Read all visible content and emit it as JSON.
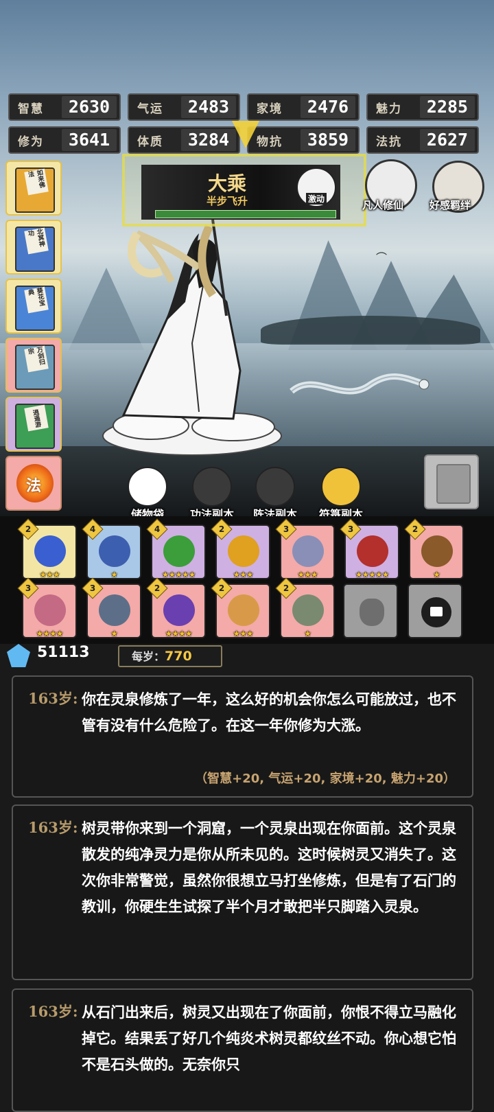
{
  "stats": [
    {
      "label": "智慧",
      "value": "2630"
    },
    {
      "label": "气运",
      "value": "2483"
    },
    {
      "label": "家境",
      "value": "2476"
    },
    {
      "label": "魅力",
      "value": "2285"
    },
    {
      "label": "修为",
      "value": "3641"
    },
    {
      "label": "体质",
      "value": "3284"
    },
    {
      "label": "物抗",
      "value": "3859"
    },
    {
      "label": "法抗",
      "value": "2627"
    }
  ],
  "realm": {
    "name": "大乘",
    "sub": "半步飞升",
    "action": "激动",
    "progress": 1.0
  },
  "portraits": [
    {
      "label": "凡人修仙",
      "icon": "taoist-character-icon"
    },
    {
      "label": "好感羁绊",
      "icon": "maiden-portrait-icon"
    }
  ],
  "books": [
    {
      "title": "如来佛法",
      "color": "#e7a933",
      "bg": "#f4e7a6"
    },
    {
      "title": "北冥神功",
      "color": "#4a78c8",
      "bg": "#f4e7a6"
    },
    {
      "title": "葵花宝典",
      "color": "#4a84d6",
      "bg": "#f4e7a6"
    },
    {
      "title": "万剑归宗",
      "color": "#6b9bb8",
      "bg": "#f3aaa8"
    },
    {
      "title": "逍遥游",
      "color": "#3d9e55",
      "bg": "#cdb0e0"
    }
  ],
  "fa_button": "法",
  "mid_buttons": [
    {
      "label": "储物袋",
      "locked": false
    },
    {
      "label": "功法副本",
      "locked": true
    },
    {
      "label": "阵法副本",
      "locked": true
    },
    {
      "label": "符箓副本",
      "locked": false
    }
  ],
  "items_row1": [
    {
      "level": "2",
      "stars": "★★★",
      "bg": "#f3e6a4",
      "icon": "orb-icon"
    },
    {
      "level": "4",
      "stars": "★",
      "bg": "#a9c8e8",
      "icon": "boots-icon"
    },
    {
      "level": "4",
      "stars": "★★★★★",
      "bg": "#cfb0e2",
      "icon": "claw-icon"
    },
    {
      "level": "2",
      "stars": "★★★",
      "bg": "#cfb0e2",
      "icon": "gourd-icon"
    },
    {
      "level": "3",
      "stars": "★★★",
      "bg": "#f3aaa8",
      "icon": "staff-icon"
    },
    {
      "level": "3",
      "stars": "★★★★★",
      "bg": "#cfb0e2",
      "icon": "ring-icon"
    },
    {
      "level": "2",
      "stars": "★",
      "bg": "#f3aaa8",
      "icon": "axe-icon"
    }
  ],
  "items_row2": [
    {
      "level": "3",
      "stars": "★★★★",
      "bg": "#f3aaa8",
      "icon": "scroll-icon"
    },
    {
      "level": "3",
      "stars": "★",
      "bg": "#f3aaa8",
      "icon": "dagger-icon"
    },
    {
      "level": "2",
      "stars": "★★★★",
      "bg": "#f3aaa8",
      "icon": "mirror-icon"
    },
    {
      "level": "2",
      "stars": "★★★",
      "bg": "#f3aaa8",
      "icon": "sword-icon"
    },
    {
      "level": "2",
      "stars": "★",
      "bg": "#f3aaa8",
      "icon": "spear-icon"
    }
  ],
  "currency": {
    "value": "51113",
    "per_year_label": "每岁：",
    "per_year_value": "770"
  },
  "logs": [
    {
      "age": "163岁:",
      "text": "你在灵泉修炼了一年，这么好的机会你怎么可能放过，也不管有没有什么危险了。在这一年你修为大涨。",
      "effect": "（智慧+20, 气运+20, 家境+20, 魅力+20）"
    },
    {
      "age": "163岁:",
      "text": "树灵带你来到一个洞窟，一个灵泉出现在你面前。这个灵泉散发的纯净灵力是你从所未见的。这时候树灵又消失了。这次你非常警觉，虽然你很想立马打坐修炼，但是有了石门的教训，你硬生生试探了半个月才敢把半只脚踏入灵泉。",
      "effect": ""
    },
    {
      "age": "163岁:",
      "text": "从石门出来后，树灵又出现在了你面前，你恨不得立马融化掉它。结果丢了好几个纯炎术树灵都纹丝不动。你心想它怕不是石头做的。无奈你只",
      "effect": ""
    }
  ]
}
